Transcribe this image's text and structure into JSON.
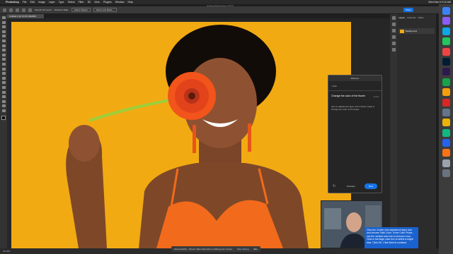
{
  "menubar": {
    "app_name": "Photoshop",
    "items": [
      "File",
      "Edit",
      "Image",
      "Layer",
      "Type",
      "Select",
      "Filter",
      "3D",
      "View",
      "Plugins",
      "Window",
      "Help"
    ],
    "status_right": "Wed Mar 8  9:16 AM"
  },
  "window": {
    "title": "Adobe Photoshop 2023"
  },
  "options_bar": {
    "sample_label": "Sample All Layers",
    "enhance_label": "Enhance Edge",
    "subject_label": "Select Subject",
    "mask_label": "Select and Mask...",
    "share_label": "Share"
  },
  "document": {
    "tab_label": "Untitled-1 @ 33.3% (RGB/8)"
  },
  "layers_panel": {
    "tabs": [
      "Layers",
      "Channels",
      "Paths"
    ],
    "active_tab": "Layers",
    "layer_name": "Background"
  },
  "discover": {
    "header": "Discover",
    "back_label": "< Exit",
    "title": "Change the color of the flower",
    "step": "2 of 3",
    "body": "Use an adjustment layer and a Select mask to change the color of the flower.",
    "previous_label": "Previous",
    "next_label": "Next"
  },
  "status": {
    "zoom": "33.33%",
    "notice_text": "Screencastify - Screen Video Recorder is sharing your screen.",
    "stop_label": "Stop sharing",
    "hide_label": "Hide"
  },
  "callout": {
    "text": "Click the Create new adjustment layer icon and choose Solid Color. In the Color Picker, use the vertical color bar to choose a hue. Click in the large color box to select a bright blue. Click OK. Click Next to continue."
  },
  "colors": {
    "canvas_bg": "#f2aa12",
    "flower": "#f2541b",
    "dress": "#f26a1b",
    "accent_blue": "#1473e6",
    "callout_blue": "#1a62cf"
  },
  "icons": [
    "apple-icon",
    "brush-icon",
    "marquee-icon",
    "lasso-icon",
    "crop-icon",
    "reload-icon",
    "wifi-icon",
    "battery-icon"
  ]
}
